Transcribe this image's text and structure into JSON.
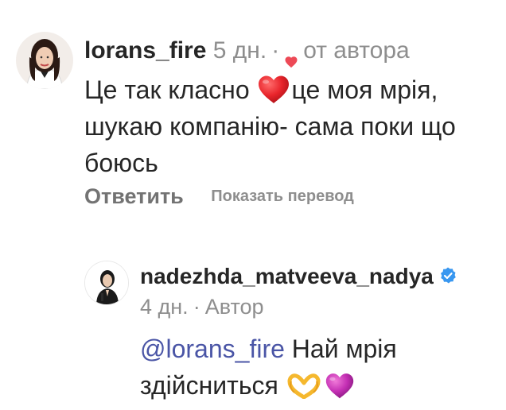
{
  "comment1": {
    "username": "lorans_fire",
    "time": "5 дн.",
    "separator": "·",
    "liked_by_author_label": "от автора",
    "text_part1": "Це так класно ",
    "text_part2": "це моя мрія, шукаю компанію- сама поки що боюсь",
    "reply_label": "Ответить",
    "translate_label": "Показать перевод",
    "heart_icon": "red-heart-icon",
    "heart_color": "#ed4956"
  },
  "comment2": {
    "username": "nadezhda_matveeva_nadya",
    "verified_icon": "verified-badge-icon",
    "verified_color": "#3897f0",
    "time": "4 дн.",
    "separator": "·",
    "author_label": "Автор",
    "mention": "@lorans_fire",
    "text": " Най мрія здійсниться",
    "emoji_1": "heart-hands-emoji",
    "emoji_2": "purple-heart-emoji"
  }
}
